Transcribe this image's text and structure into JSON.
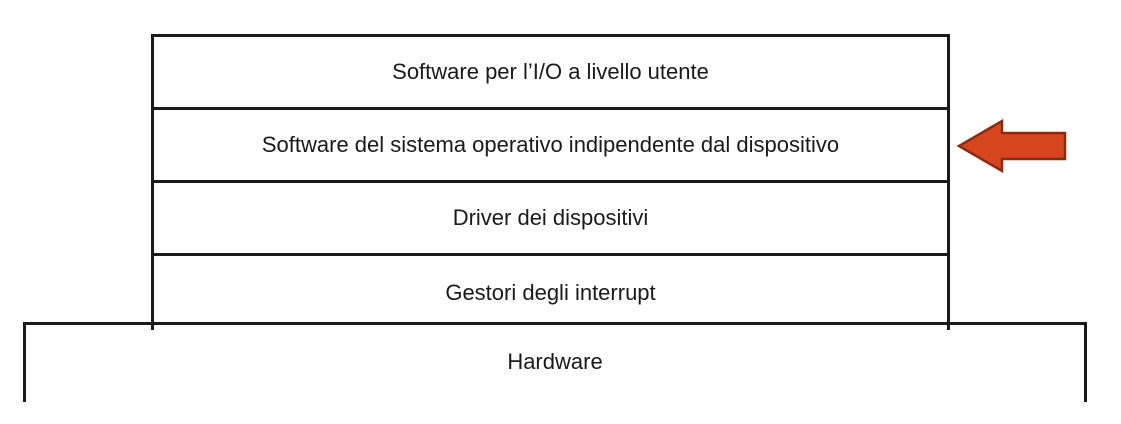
{
  "layers": [
    {
      "label": "Software per l’I/O a livello utente"
    },
    {
      "label": "Software del sistema operativo indipendente dal dispositivo"
    },
    {
      "label": "Driver dei dispositivi"
    },
    {
      "label": "Gestori degli interrupt"
    }
  ],
  "hardware": {
    "label": "Hardware"
  },
  "arrow": {
    "color": "#d5461f",
    "outline": "#8a2a10",
    "points_to": "Software del sistema operativo indipendente dal dispositivo"
  }
}
